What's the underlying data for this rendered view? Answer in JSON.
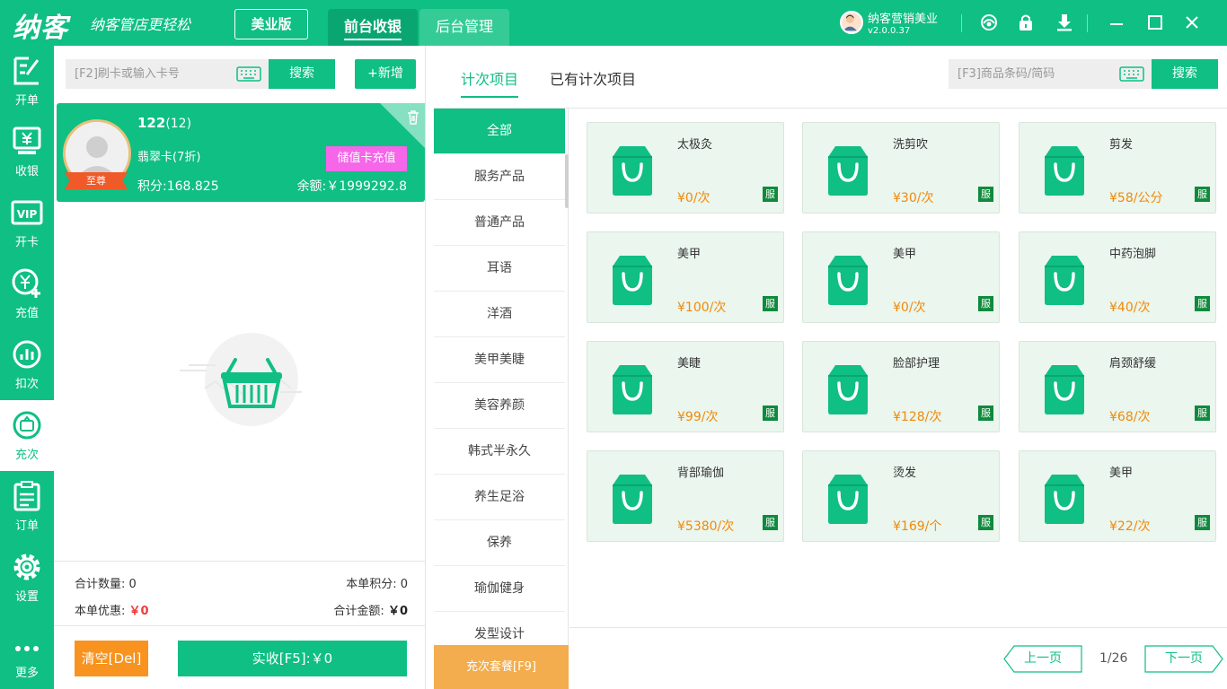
{
  "header": {
    "logo": "纳客",
    "slogan": "纳客管店更轻松",
    "edition": "美业版",
    "tabs": [
      {
        "label": "前台收银"
      },
      {
        "label": "后台管理"
      }
    ],
    "user": {
      "name": "纳客营销美业",
      "version": "v2.0.0.37"
    },
    "icons": [
      "support-icon",
      "lock-icon",
      "download-icon",
      "minimize-icon",
      "maximize-icon",
      "close-icon"
    ]
  },
  "nav": {
    "items": [
      {
        "label": "开单",
        "icon": "open-order-icon"
      },
      {
        "label": "收银",
        "icon": "cashier-icon"
      },
      {
        "label": "开卡",
        "icon": "vip-card-icon"
      },
      {
        "label": "充值",
        "icon": "recharge-icon"
      },
      {
        "label": "扣次",
        "icon": "deduct-icon"
      },
      {
        "label": "充次",
        "icon": "recharge-times-icon"
      },
      {
        "label": "订单",
        "icon": "order-icon"
      },
      {
        "label": "设置",
        "icon": "settings-icon"
      },
      {
        "label": "更多",
        "icon": "more-icon"
      }
    ],
    "active": "充次"
  },
  "left": {
    "card_placeholder": "[F2]刷卡或输入卡号",
    "search_label": "搜索",
    "add_label": "+新增",
    "member": {
      "name": "122",
      "count": "(12)",
      "rank": "至尊",
      "card": "翡翠卡(7折)",
      "points": "积分:168.825",
      "balance": "余额:￥1999292.8",
      "recharge_label": "储值卡充值"
    },
    "summary": {
      "qty_label": "合计数量:",
      "qty_value": "0",
      "points_label": "本单积分:",
      "points_value": "0",
      "discount_label": "本单优惠:",
      "discount_value": "￥0",
      "total_label": "合计金额:",
      "total_value": "￥0"
    },
    "clear_label": "清空[Del]",
    "pay_label": "实收[F5]:￥0"
  },
  "categories": {
    "items": [
      "全部",
      "服务产品",
      "普通产品",
      "耳语",
      "洋酒",
      "美甲美睫",
      "美容养颜",
      "韩式半永久",
      "养生足浴",
      "保养",
      "瑜伽健身",
      "发型设计"
    ],
    "active": "全部",
    "footer_label": "充次套餐[F9]"
  },
  "right": {
    "tabs": [
      {
        "label": "计次项目"
      },
      {
        "label": "已有计次项目"
      }
    ],
    "barcode_placeholder": "[F3]商品条码/简码",
    "search_label": "搜索",
    "products": [
      {
        "name": "太极灸",
        "price": "¥0/次",
        "badge": "服"
      },
      {
        "name": "洗剪吹",
        "price": "¥30/次",
        "badge": "服"
      },
      {
        "name": "剪发",
        "price": "¥58/公分",
        "badge": "服"
      },
      {
        "name": "美甲",
        "price": "¥100/次",
        "badge": "服"
      },
      {
        "name": "美甲",
        "price": "¥0/次",
        "badge": "服"
      },
      {
        "name": "中药泡脚",
        "price": "¥40/次",
        "badge": "服"
      },
      {
        "name": "美睫",
        "price": "¥99/次",
        "badge": "服"
      },
      {
        "name": "脸部护理",
        "price": "¥128/次",
        "badge": "服"
      },
      {
        "name": "肩颈舒缓",
        "price": "¥68/次",
        "badge": "服"
      },
      {
        "name": "背部瑜伽",
        "price": "¥5380/次",
        "badge": "服"
      },
      {
        "name": "烫发",
        "price": "¥169/个",
        "badge": "服"
      },
      {
        "name": "美甲",
        "price": "¥22/次",
        "badge": "服"
      }
    ],
    "pagination": {
      "prev_label": "上一页",
      "page": "1/26",
      "next_label": "下一页"
    }
  },
  "colors": {
    "brand": "#0fbf83",
    "price": "#f08a0a",
    "badge": "#108a3c",
    "recharge": "#f566e9",
    "clear": "#f7931e",
    "package": "#f3ad4e"
  }
}
